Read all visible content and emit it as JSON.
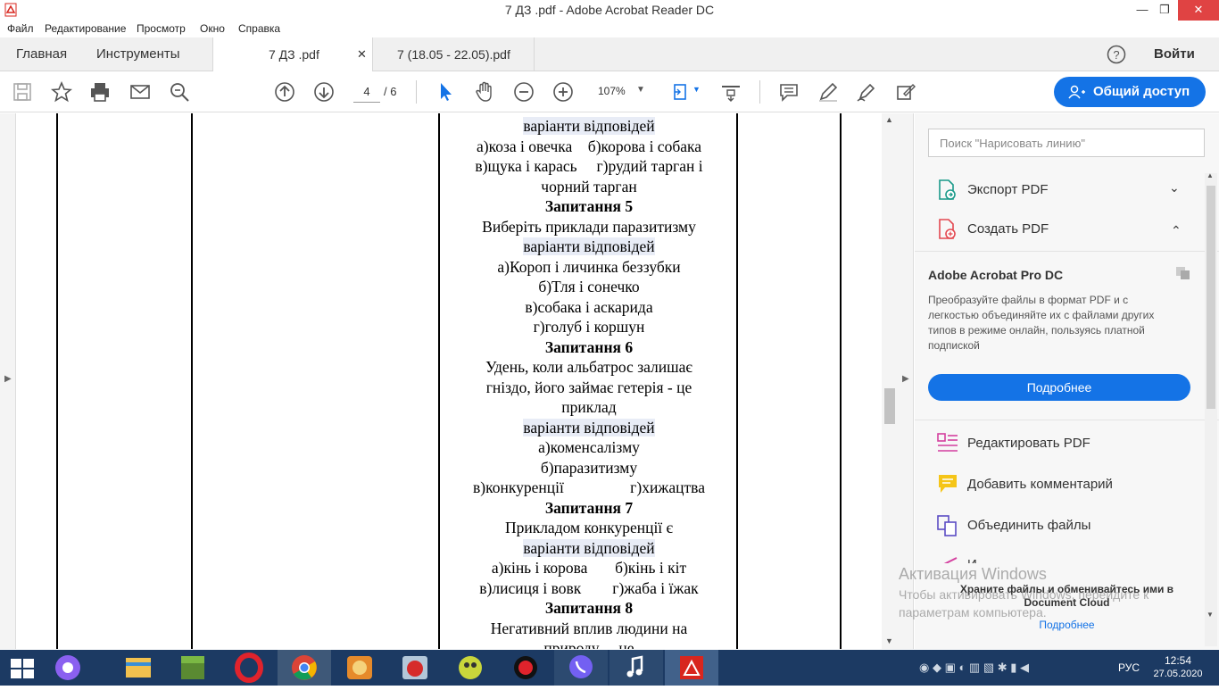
{
  "window": {
    "title": "7 ДЗ .pdf - Adobe Acrobat Reader DC",
    "minimize": "—",
    "maximize": "❐",
    "close": "✕"
  },
  "menu": [
    "Файл",
    "Редактирование",
    "Просмотр",
    "Окно",
    "Справка"
  ],
  "nav": {
    "home": "Главная",
    "tools": "Инструменты",
    "signin": "Войти"
  },
  "tabs": [
    {
      "label": "7 ДЗ .pdf",
      "close": "✕"
    },
    {
      "label": "7 (18.05 - 22.05).pdf"
    }
  ],
  "toolbar": {
    "page_current": "4",
    "page_total": "/ 6",
    "zoom": "107%",
    "share": "Общий доступ"
  },
  "document": {
    "lines": [
      "варіанти відповідей",
      "а)коза і овечка    б)корова і собака",
      "в)щука і карась     г)рудий тарган і",
      "чорний тарган",
      "Запитання 5",
      "Виберіть приклади паразитизму",
      "варіанти відповідей",
      "а)Короп і личинка беззубки",
      "б)Тля і сонечко",
      "в)собака і аскарида",
      "г)голуб і коршун",
      "Запитання 6",
      "Удень, коли альбатрос залишає",
      "гніздо, його займає гетерія - це",
      "приклад",
      "варіанти відповідей",
      "а)коменсалізму",
      "б)паразитизму",
      "в)конкуренції                 г)хижацтва",
      "Запитання 7",
      "Прикладом конкуренції є",
      "варіанти відповідей",
      "а)кінь і корова       б)кінь і кіт",
      "в)лисиця і вовк        г)жаба і їжак",
      "Запитання 8",
      "Негативний вплив людини на",
      "природу     це"
    ]
  },
  "right_panel": {
    "search_placeholder": "Поиск \"Нарисовать линию\"",
    "export_pdf": "Экспорт PDF",
    "create_pdf": "Создать PDF",
    "promo_title": "Adobe Acrobat Pro DC",
    "promo_text": [
      "Преобразуйте файлы в формат PDF и с",
      "легкостью объединяйте их с файлами других",
      "типов в режиме онлайн, пользуясь платной",
      "подпиской"
    ],
    "promo_button": "Подробнее",
    "tools": [
      "Редактировать PDF",
      "Добавить комментарий",
      "Объединить файлы",
      "И"
    ],
    "cloud_text": [
      "Храните файлы и обменивайтесь ими в",
      "Document Cloud"
    ],
    "cloud_link": "Подробнее"
  },
  "watermark": {
    "title": "Активация Windows",
    "line1": "Чтобы активировать Windows, перейдите к",
    "line2": "параметрам компьютера."
  },
  "taskbar": {
    "lang": "РУС",
    "time": "12:54",
    "date": "27.05.2020"
  },
  "colors": {
    "accent": "#1473e6",
    "taskbar": "#1c3a63",
    "highlight": "#e8ecf6"
  }
}
